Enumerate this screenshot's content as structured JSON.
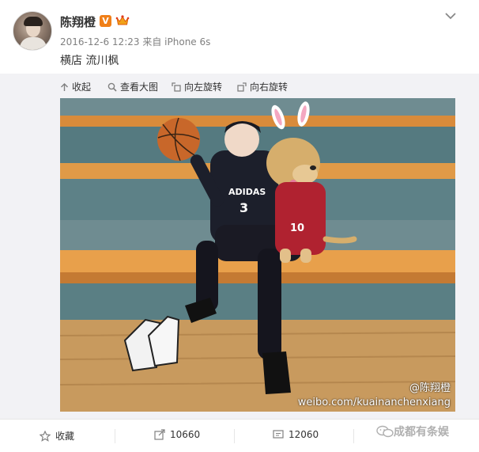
{
  "post": {
    "username": "陈翔橙",
    "verified_badge": "V",
    "timestamp": "2016-12-6 12:23",
    "source_prefix": "来自",
    "source_device": "iPhone 6s",
    "text": "横店 流川枫"
  },
  "toolbar": {
    "collapse_label": "收起",
    "view_large_label": "查看大图",
    "rotate_left_label": "向左旋转",
    "rotate_right_label": "向右旋转"
  },
  "photo": {
    "jersey_brand": "ADIDAS",
    "jersey_number": "3",
    "dog_jersey_number": "10",
    "watermark_user": "@陈翔橙",
    "watermark_url": "weibo.com/kuainanchenxiang"
  },
  "actions": {
    "favorite_label": "收藏",
    "repost_count": "10660",
    "comment_count": "12060",
    "like_label": "成都有条娱"
  },
  "colors": {
    "verified": "#f07f18",
    "media_background": "#f2f2f5"
  }
}
